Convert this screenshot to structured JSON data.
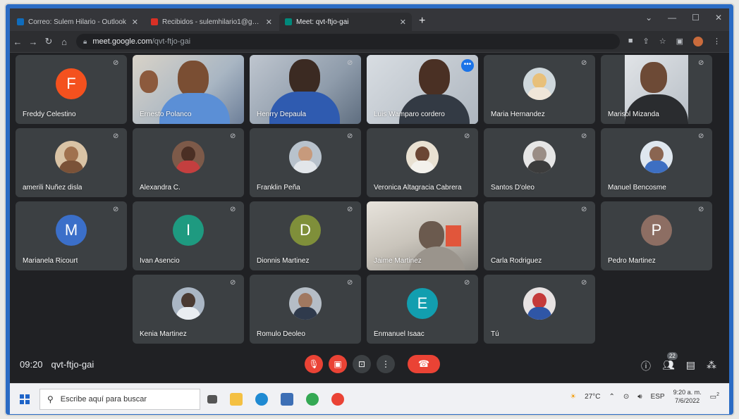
{
  "browser": {
    "tabs": [
      {
        "title": "Correo: Sulem Hilario - Outlook",
        "favicon_color": "#0f6cbd",
        "active": false
      },
      {
        "title": "Recibidos - sulemhilario1@gma...",
        "favicon_color": "#d93025",
        "active": false
      },
      {
        "title": "Meet: qvt-ftjo-gai",
        "favicon_color": "#00897b",
        "active": true
      }
    ],
    "new_tab_label": "+",
    "url_host": "meet.google.com",
    "url_path": "/qvt-ftjo-gai"
  },
  "participants": [
    {
      "name": "Freddy Celestino",
      "avatar_letter": "F",
      "avatar_color": "#f4511e"
    },
    {
      "name": "Ernesto Polanco",
      "video": true
    },
    {
      "name": "Henrry Depaula",
      "video": true
    },
    {
      "name": "Luis Wamparo cordero",
      "video": true,
      "speaking": true
    },
    {
      "name": "Maria Hernandez",
      "photo": true
    },
    {
      "name": "Marisol Mizanda",
      "video": true
    },
    {
      "name": "amerili Nuñez disla",
      "photo": true
    },
    {
      "name": "Alexandra C.",
      "photo": true
    },
    {
      "name": "Franklin Peña",
      "photo": true
    },
    {
      "name": "Veronica Altagracia Cabrera",
      "photo": true
    },
    {
      "name": "Santos D'oleo",
      "photo": true
    },
    {
      "name": "Manuel Bencosme",
      "photo": true
    },
    {
      "name": "Marianela Ricourt",
      "avatar_letter": "M",
      "avatar_color": "#3b6fc9"
    },
    {
      "name": "Ivan Asencio",
      "avatar_letter": "I",
      "avatar_color": "#1e9a80"
    },
    {
      "name": "Dionnis Martinez",
      "avatar_letter": "D",
      "avatar_color": "#7f8f3a"
    },
    {
      "name": "Jaime Martinez",
      "video": true
    },
    {
      "name": "Carla Rodriguez",
      "photo": false
    },
    {
      "name": "Pedro Martinez",
      "avatar_letter": "P",
      "avatar_color": "#8d6e63"
    },
    {
      "name": "Kenia Martinez",
      "photo": true
    },
    {
      "name": "Romulo Deoleo",
      "photo": true
    },
    {
      "name": "Enmanuel Isaac",
      "avatar_letter": "E",
      "avatar_color": "#129eaf"
    },
    {
      "name": "Tú",
      "photo": true
    }
  ],
  "meeting": {
    "time": "09:20",
    "code": "qvt-ftjo-gai",
    "people_count": "22"
  },
  "taskbar": {
    "search_placeholder": "Escribe aquí para buscar",
    "weather": "27°C",
    "language": "ESP",
    "time": "9:20 a. m.",
    "date": "7/6/2022",
    "notification_count": "2"
  }
}
